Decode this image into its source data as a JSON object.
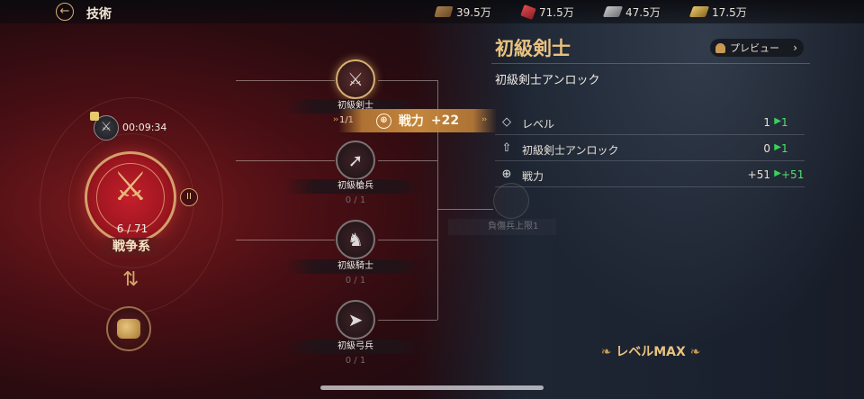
{
  "header": {
    "title": "技術",
    "resources": [
      {
        "icon": "wood-icon",
        "value": "39.5万"
      },
      {
        "icon": "ore-icon",
        "value": "71.5万"
      },
      {
        "icon": "stone-icon",
        "value": "47.5万"
      },
      {
        "icon": "gold-icon",
        "value": "17.5万"
      }
    ]
  },
  "left": {
    "timer": "00:09:34",
    "branch_progress": "6 / 71",
    "branch_name": "戦争系",
    "tier": "II"
  },
  "tree": {
    "nodes": [
      {
        "label": "初級剣士",
        "count": "1/1",
        "icon": "crossed-swords-icon"
      },
      {
        "label": "初級槍兵",
        "count": "0 / 1",
        "icon": "spear-icon"
      },
      {
        "label": "初級騎士",
        "count": "0 / 1",
        "icon": "horse-icon"
      },
      {
        "label": "初級弓兵",
        "count": "0 / 1",
        "icon": "bow-icon"
      }
    ],
    "boost": {
      "label": "戦力",
      "value": "+22"
    },
    "ghost_label": "負傷兵上限1"
  },
  "panel": {
    "title": "初級剣士",
    "preview_label": "プレビュー",
    "subtitle": "初級剣士アンロック",
    "stats": [
      {
        "icon": "level-icon",
        "name": "レベル",
        "current": "1",
        "next": "1"
      },
      {
        "icon": "unlock-arrow-icon",
        "name": "初級剣士アンロック",
        "current": "0",
        "next": "1"
      },
      {
        "icon": "power-icon",
        "name": "戦力",
        "current": "+51",
        "next": "+51"
      }
    ],
    "level_max": "レベルMAX"
  },
  "colors": {
    "accent_gold": "#e9c27f",
    "up_green": "#52e06d",
    "emblem_red": "#c41f2b"
  }
}
